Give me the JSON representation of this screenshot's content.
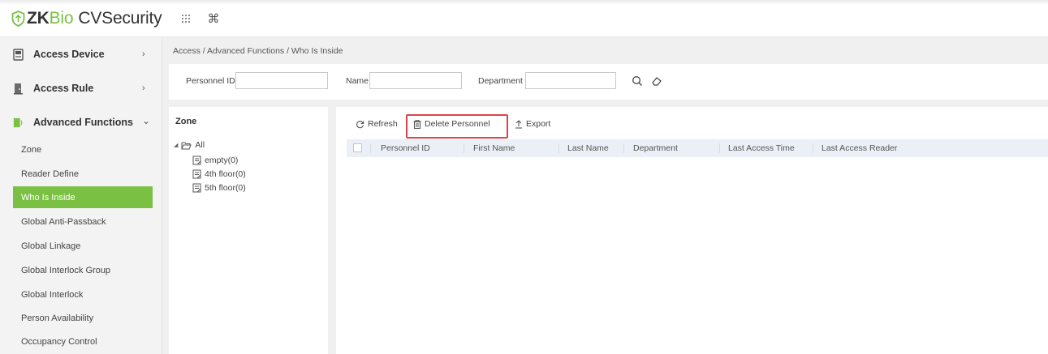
{
  "app": {
    "logo_zk": "ZK",
    "logo_bio": "Bio",
    "logo_rest": "CVSecurity",
    "top_icons": [
      "grid-icon",
      "command-icon"
    ]
  },
  "sidebar": {
    "menus": [
      {
        "label": "Access Device",
        "icon": "device-icon",
        "chevron": "›"
      },
      {
        "label": "Access Rule",
        "icon": "door-icon",
        "chevron": "›"
      },
      {
        "label": "Advanced Functions",
        "icon": "advanced-icon",
        "chevron": "⌄"
      }
    ],
    "sub_items": [
      {
        "label": "Zone"
      },
      {
        "label": "Reader Define"
      },
      {
        "label": "Who Is Inside",
        "active": true
      },
      {
        "label": "Global Anti-Passback"
      },
      {
        "label": "Global Linkage"
      },
      {
        "label": "Global Interlock Group"
      },
      {
        "label": "Global Interlock"
      },
      {
        "label": "Person Availability"
      },
      {
        "label": "Occupancy Control"
      }
    ]
  },
  "breadcrumb": "Access / Advanced Functions / Who Is Inside",
  "filter": {
    "personnel_id_label": "Personnel ID",
    "personnel_id_value": "",
    "name_label": "Name",
    "name_value": "",
    "department_label": "Department",
    "department_value": ""
  },
  "zone": {
    "title": "Zone",
    "root": "All",
    "children": [
      "empty(0)",
      "4th floor(0)",
      "5th floor(0)"
    ]
  },
  "toolbar": {
    "refresh": "Refresh",
    "delete_personnel": "Delete Personnel",
    "export": "Export"
  },
  "grid": {
    "columns": [
      "Personnel ID",
      "First Name",
      "Last Name",
      "Department",
      "Last Access Time",
      "Last Access Reader"
    ],
    "rows": []
  },
  "colors": {
    "accent": "#7ac143",
    "highlight": "#e0424a",
    "header_bg": "#eaf0f6"
  }
}
